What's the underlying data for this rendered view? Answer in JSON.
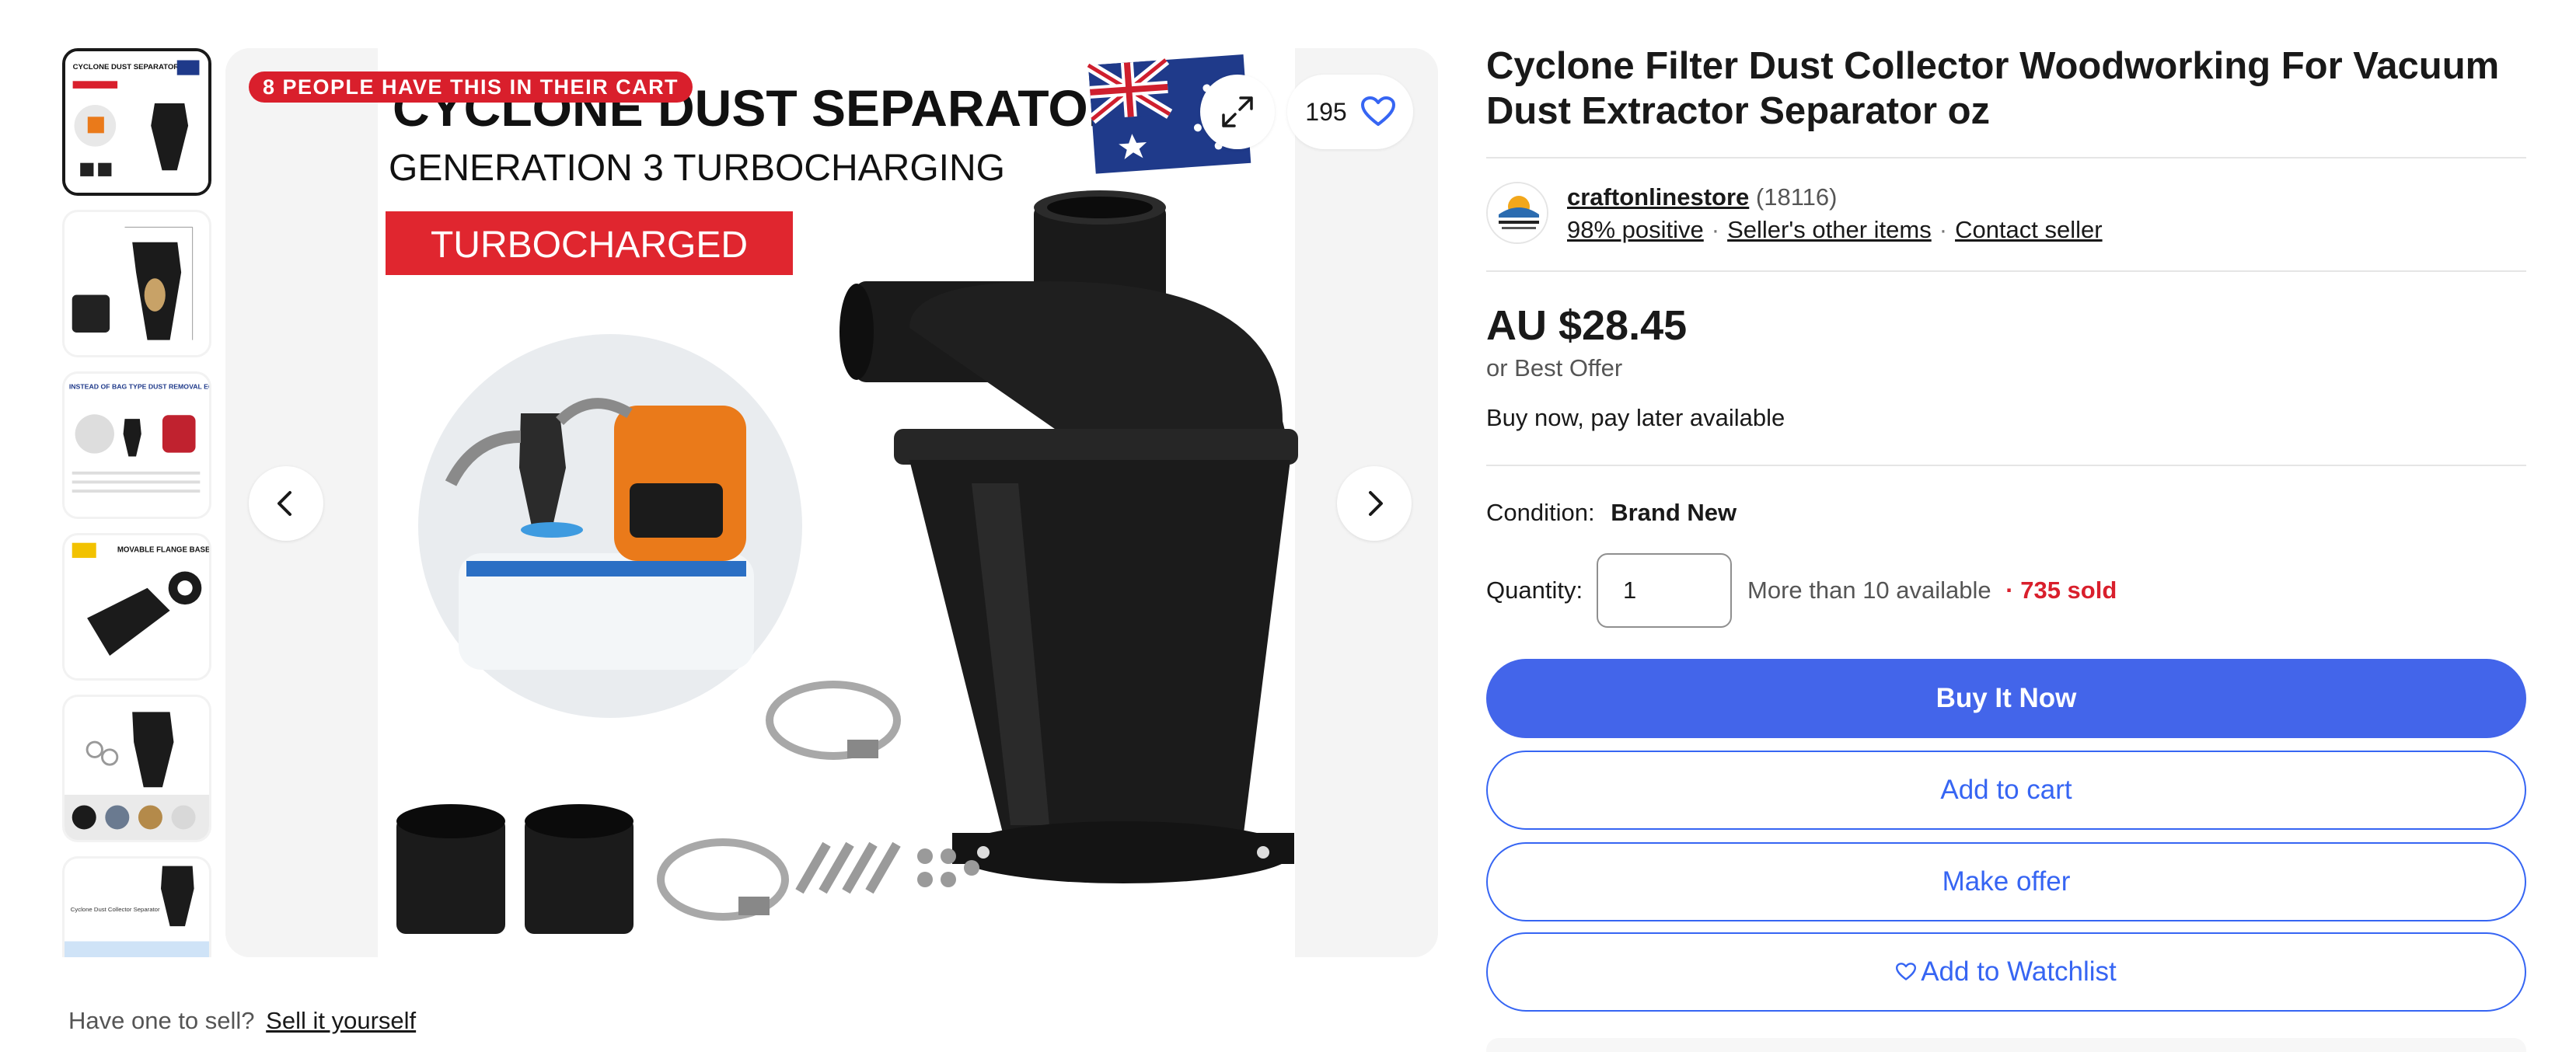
{
  "gallery": {
    "thumbnails": [
      {
        "name": "thumbnail-1",
        "selected": true,
        "caption": "CYCLONE DUST SEPARATOR"
      },
      {
        "name": "thumbnail-2",
        "selected": false,
        "caption": ""
      },
      {
        "name": "thumbnail-3",
        "selected": false,
        "caption": "INSTEAD OF BAG TYPE DUST REMOVAL EQUIPMENT"
      },
      {
        "name": "thumbnail-4",
        "selected": false,
        "caption": "MOVABLE FLANGE BASE"
      },
      {
        "name": "thumbnail-5",
        "selected": false,
        "caption": ""
      },
      {
        "name": "thumbnail-6",
        "selected": false,
        "caption": "Cyclone Dust Collector Separator"
      }
    ],
    "main": {
      "cart_badge": "8 PEOPLE HAVE THIS IN THEIR CART",
      "watch_count": "195",
      "image_heading": "CYCLONE DUST SEPARATOR",
      "image_subheading": "GENERATION 3  TURBOCHARGING",
      "image_banner": "TURBOCHARGED"
    },
    "icons": {
      "expand": "expand-icon",
      "heart": "heart-icon",
      "prev": "chevron-left-icon",
      "next": "chevron-right-icon"
    }
  },
  "sell": {
    "prompt": "Have one to sell?",
    "link": "Sell it yourself"
  },
  "listing": {
    "title": "Cyclone Filter Dust Collector Woodworking For Vacuum Dust Extractor Separator oz",
    "seller": {
      "name": "craftonlinestore",
      "feedback_count": "(18116)",
      "positive": "98% positive",
      "other_items": "Seller's other items",
      "contact": "Contact seller"
    },
    "price": "AU $28.45",
    "best_offer": "or Best Offer",
    "pay_later": "Buy now, pay later available",
    "condition_label": "Condition:",
    "condition_value": "Brand New",
    "quantity_label": "Quantity:",
    "quantity_value": "1",
    "availability": "More than 10 available",
    "sold": "· 735 sold",
    "buttons": {
      "buy_now": "Buy It Now",
      "add_to_cart": "Add to cart",
      "make_offer": "Make offer",
      "watchlist": "Add to Watchlist"
    }
  },
  "colors": {
    "primary_button": "#4365ea",
    "link_blue": "#3665f3",
    "badge_red": "#d91f2c",
    "sold_red": "#d91f2c"
  }
}
